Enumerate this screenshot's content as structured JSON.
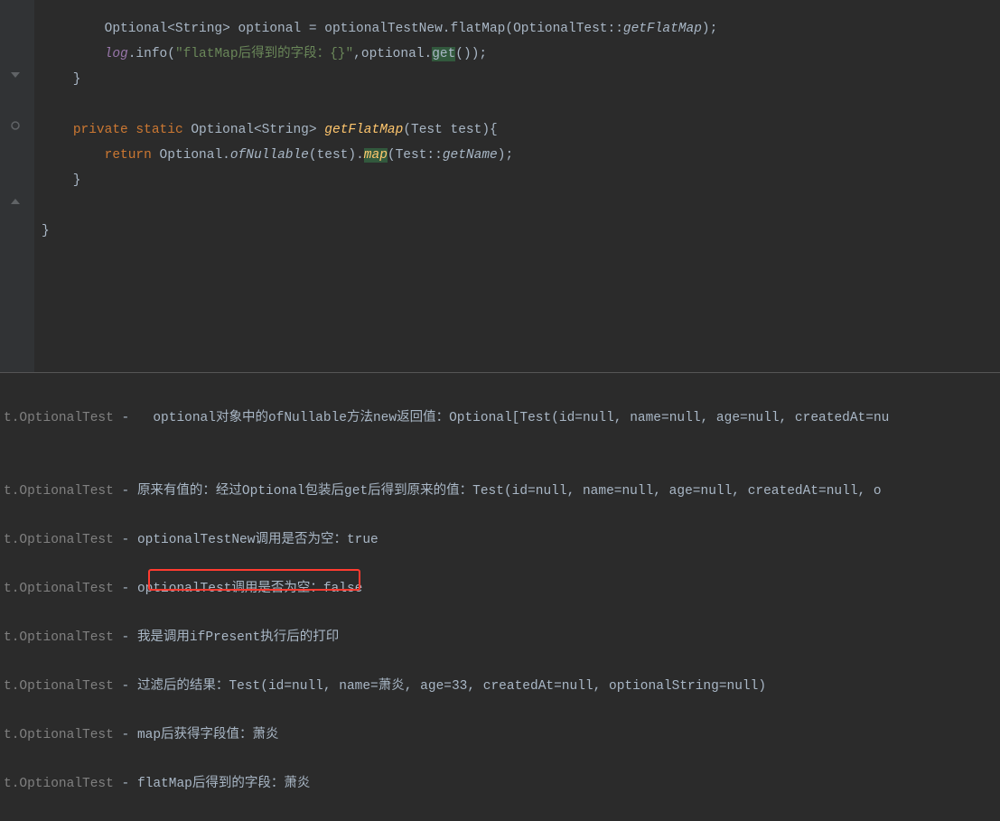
{
  "code": {
    "line1_a": "        Optional<String> optional = optionalTestNew.flatMap(OptionalTest::",
    "line1_methodref": "getFlatMap",
    "line1_b": ");",
    "line2_a": "        ",
    "line2_log": "log",
    "line2_b": ".info(",
    "line2_str": "\"flatMap后得到的字段：{}\"",
    "line2_c": ",optional.",
    "line2_get": "get",
    "line2_d": "());",
    "line3": "    }",
    "line4": "",
    "line5_a": "    ",
    "line5_private": "private",
    "line5_static": " static ",
    "line5_b": "Optional<String> ",
    "line5_method": "getFlatMap",
    "line5_c": "(Test test){",
    "line6_a": "        ",
    "line6_return": "return",
    "line6_b": " Optional.",
    "line6_ofnullable": "ofNullable",
    "line6_c": "(test).",
    "line6_map": "map",
    "line6_d": "(Test::",
    "line6_getname": "getName",
    "line6_e": ");",
    "line7": "    }",
    "line8": "",
    "line9": "}"
  },
  "console": {
    "prefix": "t.OptionalTest",
    "sep": " - ",
    "lines": [
      "  optional对象中的ofNullable方法new返回值：Optional[Test(id=null, name=null, age=null, createdAt=nu",
      "",
      "原来有值的：经过Optional包装后get后得到原来的值：Test(id=null, name=null, age=null, createdAt=null, o",
      "optionalTestNew调用是否为空：true",
      "optionalTest调用是否为空：false",
      "我是调用ifPresent执行后的打印",
      "过滤后的结果：Test(id=null, name=萧炎, age=33, createdAt=null, optionalString=null)",
      "map后获得字段值：萧炎",
      "flatMap后得到的字段：萧炎"
    ]
  }
}
